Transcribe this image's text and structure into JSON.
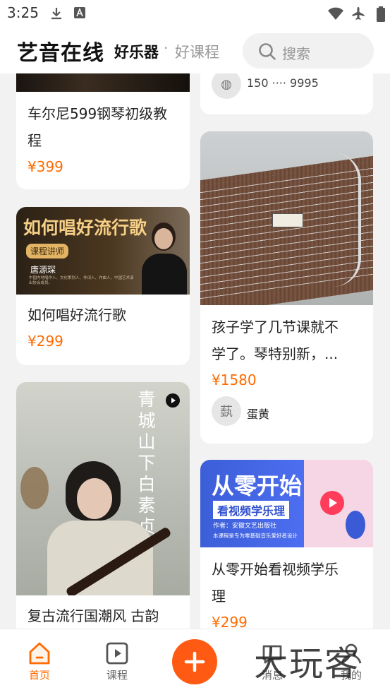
{
  "status": {
    "time": "3:25"
  },
  "header": {
    "app_title": "艺音在线",
    "tab_active": "好乐器",
    "separator": "·",
    "tab_inactive": "好课程",
    "search_placeholder": "搜索"
  },
  "cards": {
    "c1": {
      "title": "车尔尼599钢琴初级教程",
      "price": "¥399"
    },
    "c2": {
      "title": "如何唱好流行歌",
      "price": "¥299",
      "banner_title": "如何唱好流行歌",
      "tag": "课程讲师",
      "teacher": "唐源琛",
      "teacher_desc": "中国内地唱作人、文化策划人、作词人、作曲人，中国艺术演出协会成员。"
    },
    "c3": {
      "title": "复古流行国潮风 古韵",
      "poster_text": "青城山下白素贞"
    },
    "c4": {
      "author_partial": "150 ···· 9995"
    },
    "c5": {
      "title_line1": "孩子学了几节课就不",
      "title_line2": "学了。琴特别新，...",
      "price": "¥1580",
      "author": "蛋黄",
      "avatar_text": "蓺"
    },
    "c6": {
      "title_line1": "从零开始看视频学乐",
      "title_line2": "理",
      "price": "¥299",
      "banner_title": "从零开始",
      "banner_sub": "看视频学乐理",
      "banner_author": "作者：安徽文艺出版社",
      "banner_desc": "本课程是专为零基础音乐爱好者设计"
    }
  },
  "nav": {
    "home": "首页",
    "courses": "课程",
    "messages": "消息",
    "mine": "我的"
  },
  "watermark": "大玩客",
  "colors": {
    "accent": "#ff6a00",
    "fab": "#ff5a14"
  }
}
